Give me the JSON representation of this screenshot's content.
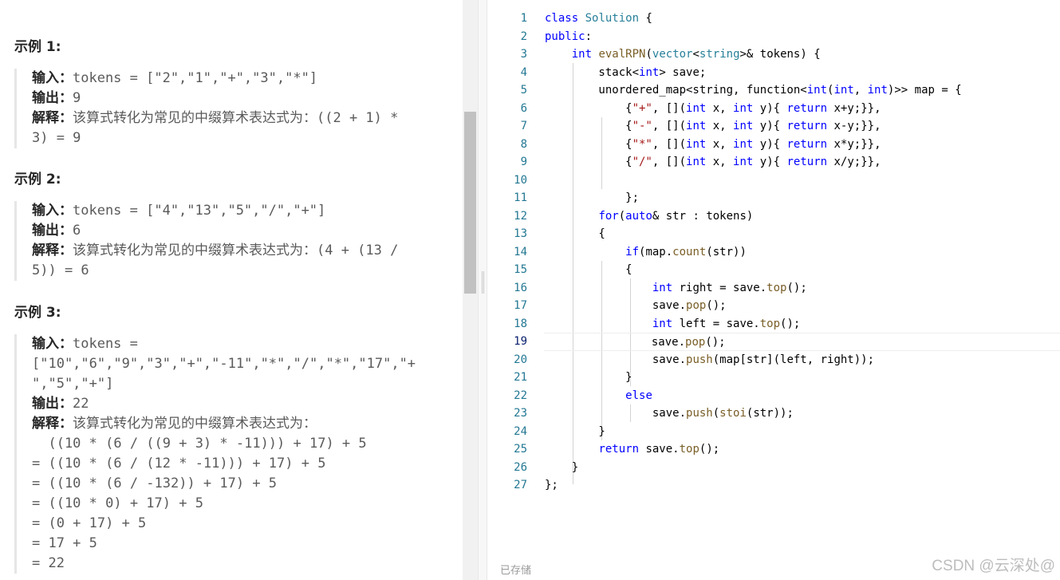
{
  "examples": [
    {
      "heading": "示例 1:",
      "lines": [
        {
          "label": "输入：",
          "text": "tokens = [\"2\",\"1\",\"+\",\"3\",\"*\"]"
        },
        {
          "label": "输出：",
          "text": "9"
        },
        {
          "label": "解释：",
          "cn": "该算式转化为常见的中缀算术表达式为：",
          "text": "((2 + 1) *"
        },
        {
          "label": "",
          "text": "3) = 9"
        }
      ]
    },
    {
      "heading": "示例 2:",
      "lines": [
        {
          "label": "输入：",
          "text": "tokens = [\"4\",\"13\",\"5\",\"/\",\"+\"]"
        },
        {
          "label": "输出：",
          "text": "6"
        },
        {
          "label": "解释：",
          "cn": "该算式转化为常见的中缀算术表达式为：",
          "text": "(4 + (13 /"
        },
        {
          "label": "",
          "text": "5)) = 6"
        }
      ]
    },
    {
      "heading": "示例 3:",
      "lines": [
        {
          "label": "输入：",
          "text": "tokens ="
        },
        {
          "label": "",
          "text": "[\"10\",\"6\",\"9\",\"3\",\"+\",\"-11\",\"*\",\"/\",\"*\",\"17\",\"+"
        },
        {
          "label": "",
          "text": "\",\"5\",\"+\"]"
        },
        {
          "label": "输出：",
          "text": "22"
        },
        {
          "label": "解释：",
          "cn": "该算式转化为常见的中缀算术表达式为：",
          "text": ""
        },
        {
          "label": "",
          "text": "  ((10 * (6 / ((9 + 3) * -11))) + 17) + 5"
        },
        {
          "label": "",
          "text": "= ((10 * (6 / (12 * -11))) + 17) + 5"
        },
        {
          "label": "",
          "text": "= ((10 * (6 / -132)) + 17) + 5"
        },
        {
          "label": "",
          "text": "= ((10 * 0) + 17) + 5"
        },
        {
          "label": "",
          "text": "= (0 + 17) + 5"
        },
        {
          "label": "",
          "text": "= 17 + 5"
        },
        {
          "label": "",
          "text": "= 22"
        }
      ]
    }
  ],
  "editor": {
    "line_numbers": [
      "1",
      "2",
      "3",
      "4",
      "5",
      "6",
      "7",
      "8",
      "9",
      "10",
      "11",
      "12",
      "13",
      "14",
      "15",
      "16",
      "17",
      "18",
      "19",
      "20",
      "21",
      "22",
      "23",
      "24",
      "25",
      "26",
      "27"
    ],
    "current_line": 19,
    "status": "已存储"
  },
  "watermark": "CSDN @云深处@",
  "colors": {
    "keyword": "#0000ff",
    "type": "#267f99",
    "function": "#795e26",
    "string": "#a31515",
    "line_number": "#237893"
  }
}
